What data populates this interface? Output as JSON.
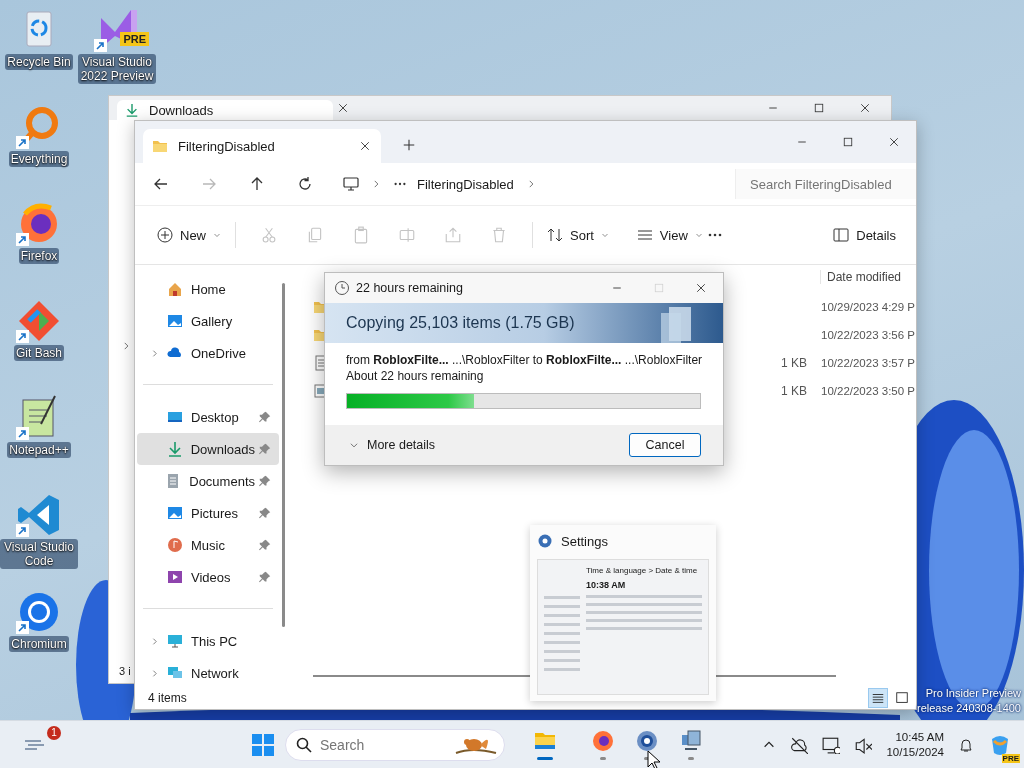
{
  "desktop_icons": [
    {
      "label": "Recycle Bin"
    },
    {
      "label": "Visual Studio 2022 Preview",
      "badge": "PRE"
    },
    {
      "label": "Everything"
    },
    {
      "label": "Firefox"
    },
    {
      "label": "Git Bash"
    },
    {
      "label": "Notepad++"
    },
    {
      "label": "Visual Studio Code"
    },
    {
      "label": "Chromium"
    }
  ],
  "back_window": {
    "tab_title": "Downloads",
    "status_text": "3 i"
  },
  "window": {
    "tab_title": "FilteringDisabled",
    "nav": [
      {
        "disabled": false
      },
      {
        "disabled": true
      },
      {
        "disabled": false
      },
      {
        "disabled": false
      }
    ],
    "address": {
      "current": "FilteringDisabled"
    },
    "search": {
      "placeholder": "Search FilteringDisabled"
    },
    "toolbar": {
      "new_label": "New",
      "actions": [
        {
          "disabled": true
        },
        {
          "disabled": true
        },
        {
          "disabled": true
        },
        {
          "disabled": true
        },
        {
          "disabled": true
        },
        {
          "disabled": true
        }
      ],
      "sort_label": "Sort",
      "view_label": "View",
      "details_label": "Details"
    },
    "sidebar": [
      [
        {
          "label": "Home",
          "expandable": false,
          "pinned": false,
          "selected": false
        },
        {
          "label": "Gallery",
          "expandable": false,
          "pinned": false,
          "selected": false
        },
        {
          "label": "OneDrive",
          "expandable": true,
          "pinned": false,
          "selected": false
        }
      ],
      [
        {
          "label": "Desktop",
          "expandable": false,
          "pinned": true,
          "selected": false
        },
        {
          "label": "Downloads",
          "expandable": false,
          "pinned": true,
          "selected": true
        },
        {
          "label": "Documents",
          "expandable": false,
          "pinned": true,
          "selected": false
        },
        {
          "label": "Pictures",
          "expandable": false,
          "pinned": true,
          "selected": false
        },
        {
          "label": "Music",
          "expandable": false,
          "pinned": true,
          "selected": false
        },
        {
          "label": "Videos",
          "expandable": false,
          "pinned": true,
          "selected": false
        }
      ],
      [
        {
          "label": "This PC",
          "expandable": true,
          "pinned": false,
          "selected": false
        },
        {
          "label": "Network",
          "expandable": true,
          "pinned": false,
          "selected": false
        }
      ]
    ],
    "files": {
      "date_header": "Date modified",
      "rows": [
        {
          "kind": "folder",
          "date": "10/29/2023 4:29 P"
        },
        {
          "kind": "folder",
          "date": "10/22/2023 3:56 P"
        },
        {
          "kind": "text",
          "size": "1 KB",
          "date": "10/22/2023 3:57 P"
        },
        {
          "kind": "image",
          "size": "1 KB",
          "date": "10/22/2023 3:50 P"
        }
      ]
    },
    "status_bar": {
      "text": "4 items",
      "views": [
        {
          "selected": true
        },
        {
          "selected": false
        }
      ]
    }
  },
  "copy_dialog": {
    "title": "22 hours remaining",
    "maximize_disabled": true,
    "heading": "Copying 25,103 items (1.75 GB)",
    "from_line": "from **RobloxFilte...**  ...\\RobloxFilter to **RobloxFilte...**  ...\\RobloxFilter",
    "status": "About 22 hours remaining",
    "level": 0.36,
    "more_details": "More details",
    "cancel": "Cancel"
  },
  "settings_preview": {
    "title": "Settings",
    "breadcrumb": "Time & language  >  Date & time",
    "time": "10:38 AM"
  },
  "watermark": [
    "Pro Insider Preview",
    "release 240308-1400"
  ],
  "taskbar": {
    "widgets_badge": "1",
    "search_placeholder": "Search",
    "apps": [
      {
        "active": true
      },
      {
        "active": false
      },
      {
        "active": false
      },
      {
        "active": false
      }
    ],
    "time": "10:45 AM",
    "date": "10/15/2024",
    "copilot_badge": "PRE"
  }
}
